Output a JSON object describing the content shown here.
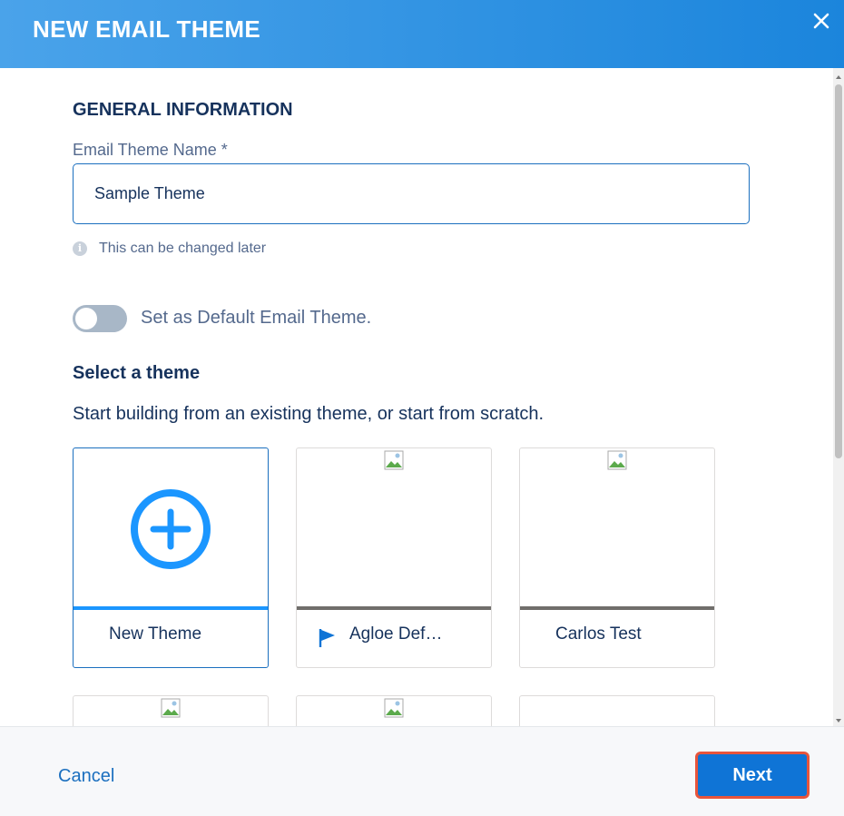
{
  "modal": {
    "title": "NEW EMAIL THEME",
    "close_icon": "close-icon"
  },
  "general": {
    "section_title": "GENERAL INFORMATION",
    "name_label": "Email Theme Name *",
    "name_value": "Sample Theme",
    "hint_icon": "info-icon",
    "hint": "This can be changed later",
    "default_toggle": {
      "label": "Set as Default Email Theme.",
      "checked": false
    }
  },
  "themes": {
    "title": "Select a theme",
    "description": "Start building from an existing theme, or start from scratch.",
    "cards": [
      {
        "label": "New Theme",
        "icon": "plus-circle-icon",
        "selected": true
      },
      {
        "label": "Agloe Def…",
        "icon": "flag-icon",
        "selected": false
      },
      {
        "label": "Carlos Test",
        "icon": "",
        "selected": false
      }
    ]
  },
  "footer": {
    "cancel_label": "Cancel",
    "next_label": "Next"
  },
  "colors": {
    "header_start": "#4aa3ea",
    "header_end": "#1b85dc",
    "primary": "#0f74d6",
    "highlight": "#e8553c"
  }
}
